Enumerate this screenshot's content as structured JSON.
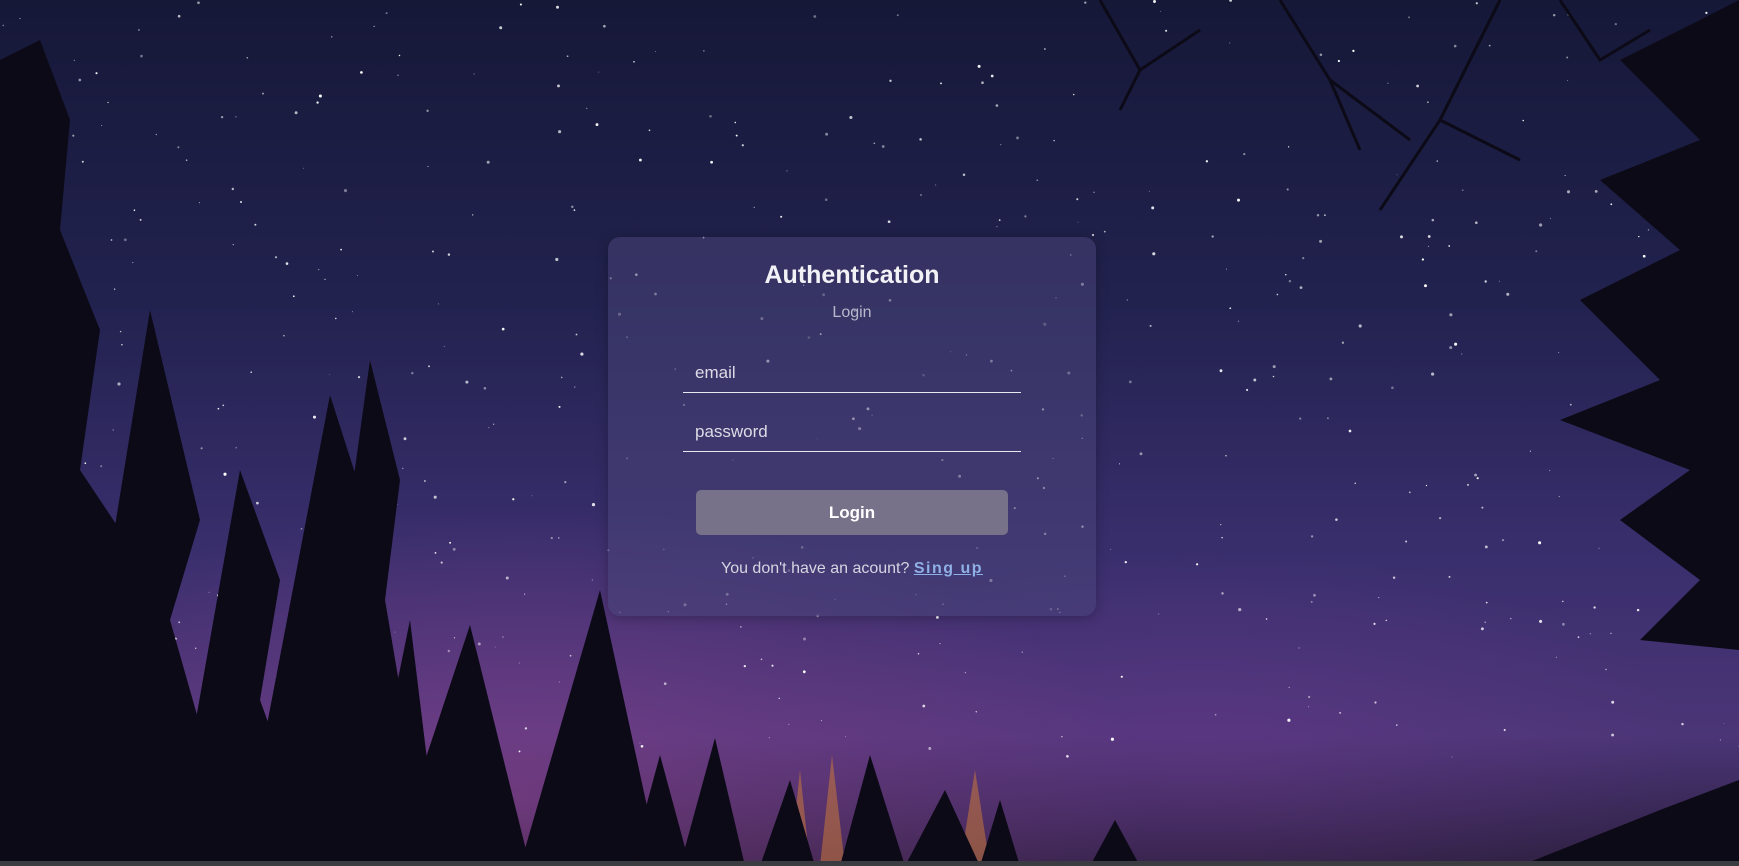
{
  "auth": {
    "title": "Authentication",
    "subtitle": "Login",
    "email_placeholder": "email",
    "password_placeholder": "password",
    "login_label": "Login",
    "signup_prompt": "You don't have an acount?",
    "signup_link": "Sing up"
  },
  "colors": {
    "card_background": "#48447888",
    "button_background": "#77718a",
    "link_color": "#8fb0e6"
  }
}
